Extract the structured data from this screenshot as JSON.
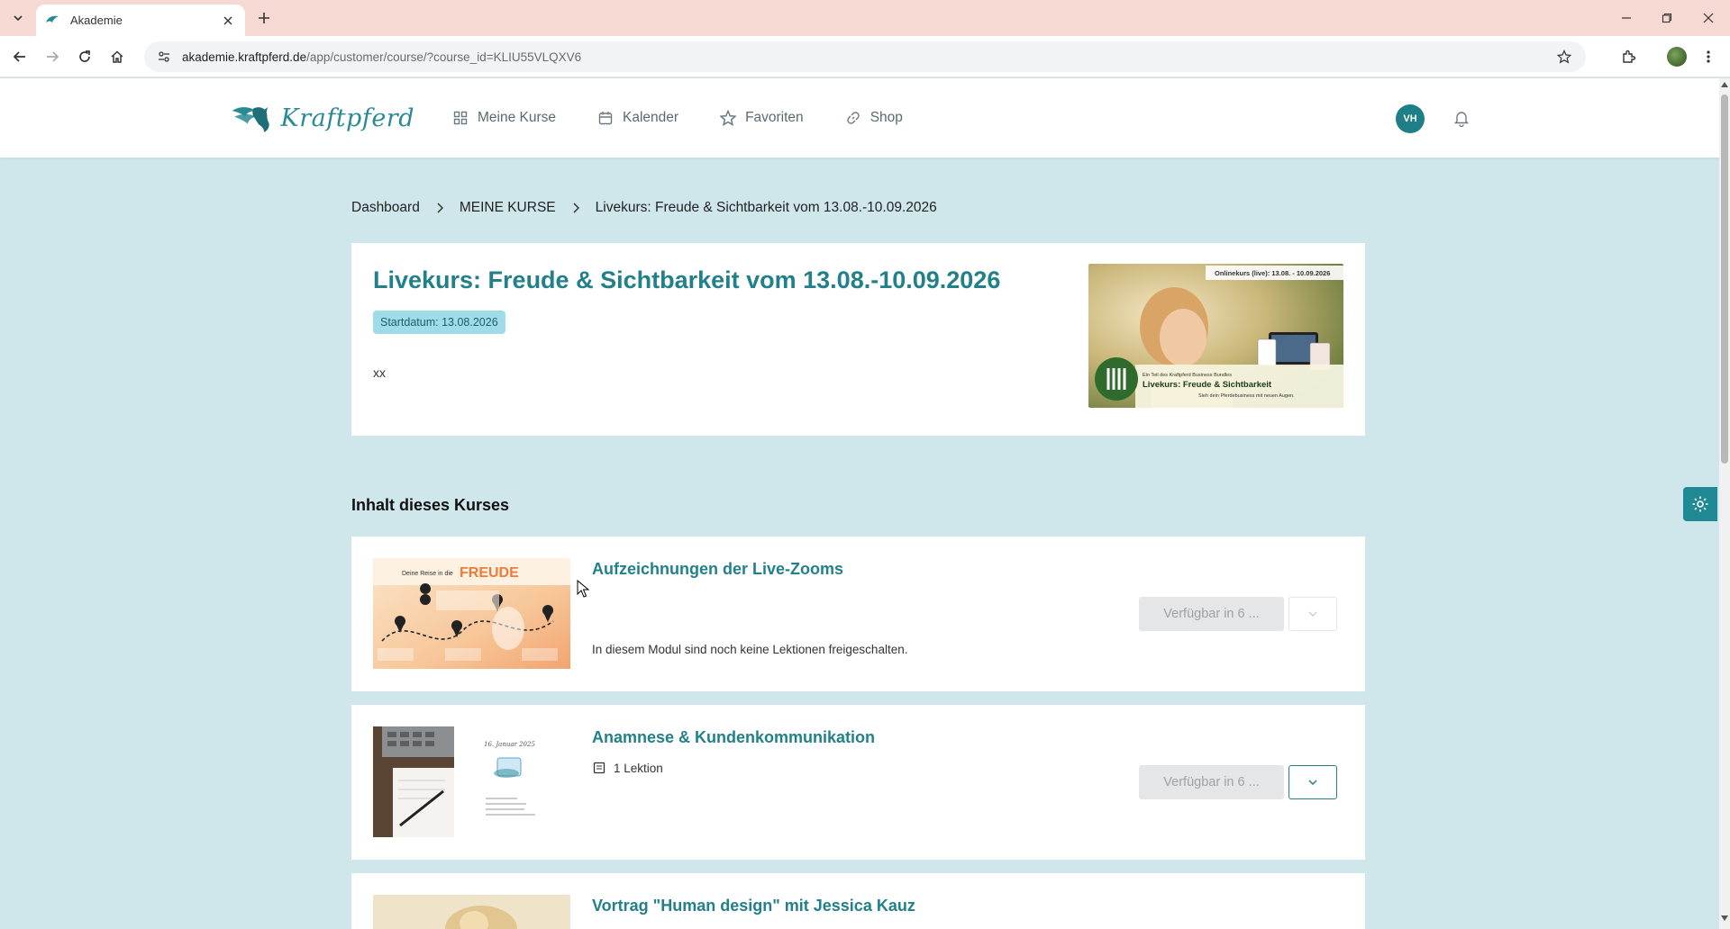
{
  "browser": {
    "tab_title": "Akademie",
    "url_host": "akademie.kraftpferd.de",
    "url_path": "/app/customer/course/?course_id=KLIU55VLQXV6"
  },
  "header": {
    "logo_text": "Kraftpferd",
    "nav": [
      {
        "label": "Meine Kurse",
        "icon": "grid-icon"
      },
      {
        "label": "Kalender",
        "icon": "calendar-icon"
      },
      {
        "label": "Favoriten",
        "icon": "star-icon"
      },
      {
        "label": "Shop",
        "icon": "link-icon"
      }
    ],
    "avatar_initials": "VH"
  },
  "breadcrumb": [
    "Dashboard",
    "MEINE KURSE",
    "Livekurs: Freude & Sichtbarkeit vom 13.08.-10.09.2026"
  ],
  "course": {
    "title": "Livekurs: Freude & Sichtbarkeit vom 13.08.-10.09.2026",
    "start_badge": "Startdatum: 13.08.2026",
    "description": "xx",
    "image_caption_top": "Onlinekurs (live): 13.08. - 10.09.2026",
    "image_caption_small": "Ein Teil des Kraftpferd Business Bundles",
    "image_caption_title": "Livekurs: Freude & Sichtbarkeit",
    "image_caption_sub": "Sieh dein Pferdebusiness mit neuen Augen."
  },
  "section_title": "Inhalt dieses Kurses",
  "modules": [
    {
      "title": "Aufzeichnungen der Live-Zooms",
      "subtitle": "In diesem Modul sind noch keine Lektionen freigeschalten.",
      "button": "Verfügbar in 6 ...",
      "thumb_text_a": "Deine Reise in die",
      "thumb_text_b": "FREUDE"
    },
    {
      "title": "Anamnese & Kundenkommunikation",
      "lessons": "1 Lektion",
      "button": "Verfügbar in 6 ...",
      "thumb_date": "16. Januar 2025"
    },
    {
      "title": "Vortrag \"Human design\" mit Jessica Kauz"
    }
  ],
  "colors": {
    "accent": "#22808a",
    "page_bg": "#cfe7ea",
    "badge_bg": "#9fdce8",
    "tab_bar": "#f7d9d3"
  }
}
